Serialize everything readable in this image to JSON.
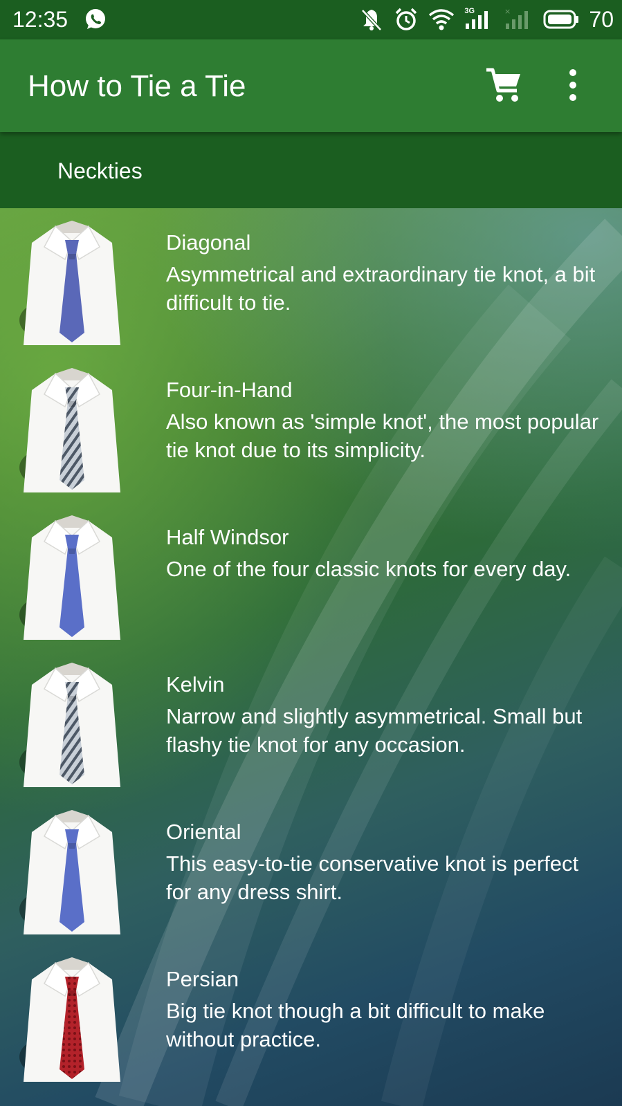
{
  "status_bar": {
    "time": "12:35",
    "battery": "70",
    "network_label": "3G",
    "icons": [
      "whatsapp-icon",
      "notifications-off-icon",
      "alarm-icon",
      "wifi-icon",
      "signal-3g-icon",
      "signal-no-sim-icon",
      "battery-icon"
    ]
  },
  "app_bar": {
    "title": "How to Tie a Tie",
    "actions": [
      "cart-icon",
      "more-vert-icon"
    ]
  },
  "tabs": {
    "active": "Neckties"
  },
  "colors": {
    "status_bar": "#1b5e20",
    "app_bar": "#2e7d32",
    "tab_bar": "#1b5e20",
    "text": "#ffffff"
  },
  "ties": [
    {
      "title": "Diagonal",
      "description": "Asymmetrical and extraordinary tie knot, a bit difficult to tie.",
      "tie_color": "#5a68b8",
      "pattern": "solid"
    },
    {
      "title": "Four-in-Hand",
      "description": "Also known as 'simple knot', the most popular tie knot due to its simplicity.",
      "tie_color": "#9aa6b2",
      "pattern": "striped"
    },
    {
      "title": "Half Windsor",
      "description": "One of the four classic knots for every day.",
      "tie_color": "#5a6fc8",
      "pattern": "solid"
    },
    {
      "title": "Kelvin",
      "description": "Narrow and slightly asymmetrical. Small but flashy tie knot for any occasion.",
      "tie_color": "#9aa6b2",
      "pattern": "striped"
    },
    {
      "title": "Oriental",
      "description": "This easy-to-tie conservative knot is perfect for any dress shirt.",
      "tie_color": "#5a6fc8",
      "pattern": "solid"
    },
    {
      "title": "Persian",
      "description": "Big tie knot though a bit difficult to make without practice.",
      "tie_color": "#b3222a",
      "pattern": "paisley"
    }
  ]
}
